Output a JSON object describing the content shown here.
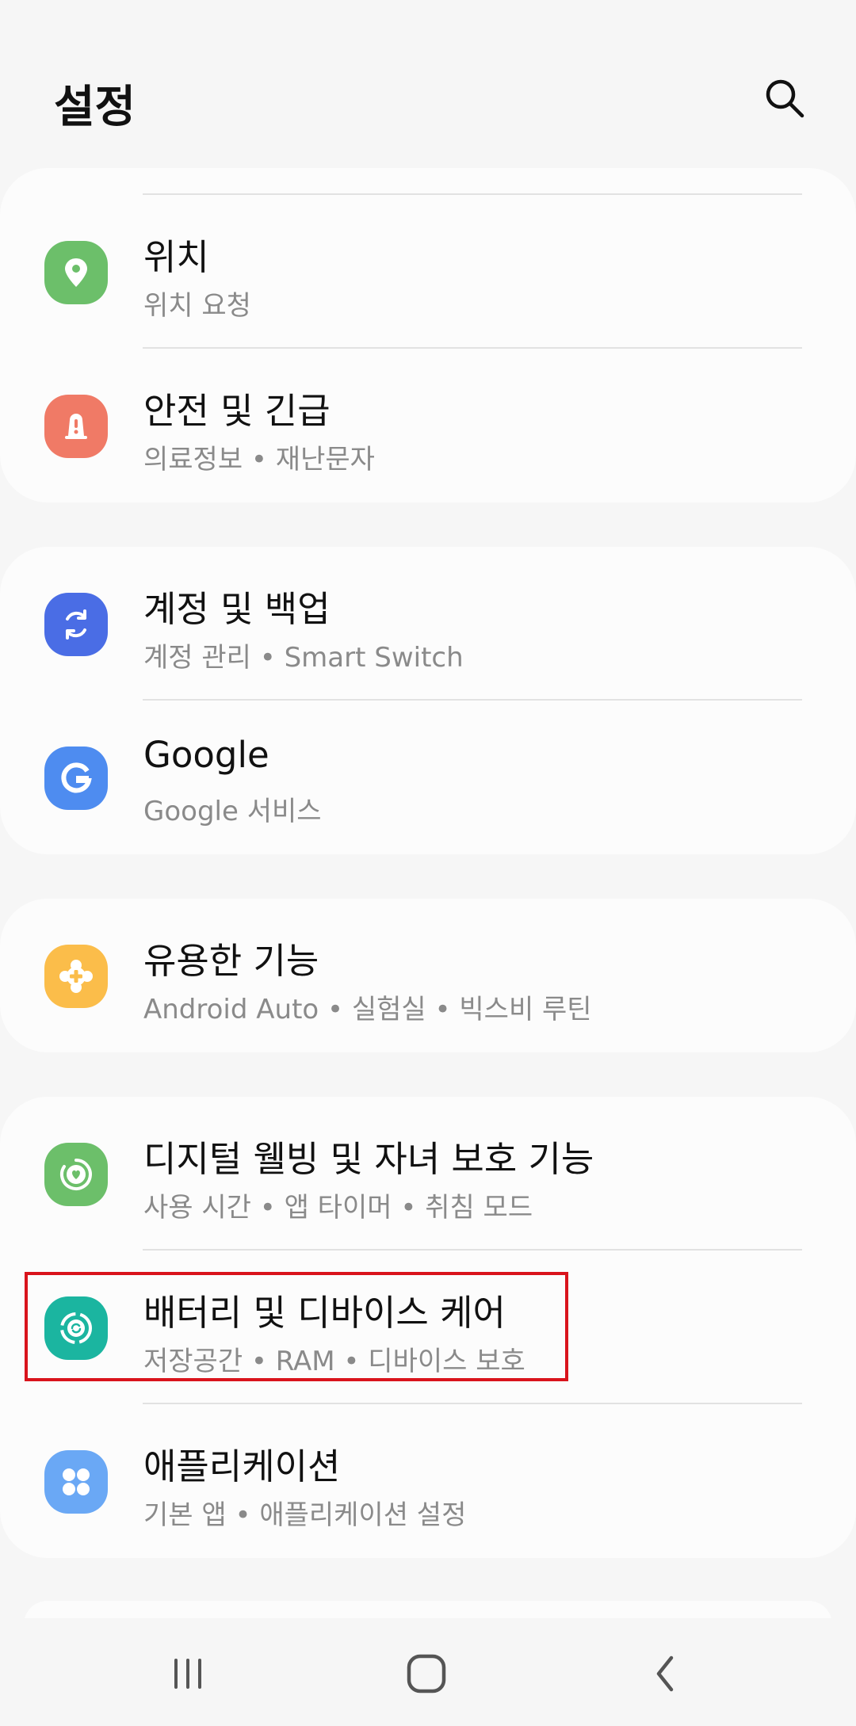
{
  "header": {
    "title": "설정"
  },
  "cards": [
    {
      "items": [
        {
          "title": "위치",
          "subtitle": "위치 요청",
          "icon": "location-pin-icon",
          "color": "#6cbf6a"
        },
        {
          "title": "안전 및 긴급",
          "subtitle": "의료정보  •  재난문자",
          "icon": "emergency-siren-icon",
          "color": "#f07a66"
        }
      ]
    },
    {
      "items": [
        {
          "title": "계정 및 백업",
          "subtitle": "계정 관리  •  Smart Switch",
          "icon": "sync-arrows-icon",
          "color": "#4a6de5"
        },
        {
          "title": "Google",
          "subtitle": "Google 서비스",
          "icon": "google-g-icon",
          "color": "#4e8cf0"
        }
      ]
    },
    {
      "items": [
        {
          "title": "유용한 기능",
          "subtitle": "Android Auto  •  실험실  •  빅스비 루틴",
          "icon": "puzzle-plus-icon",
          "color": "#fbbd4a"
        }
      ]
    },
    {
      "items": [
        {
          "title": "디지털 웰빙 및 자녀 보호 기능",
          "subtitle": "사용 시간  •  앱 타이머  •  취침 모드",
          "icon": "wellbeing-heart-icon",
          "color": "#6cbf6a"
        },
        {
          "title": "배터리 및 디바이스 케어",
          "subtitle": "저장공간  •  RAM  •  디바이스 보호",
          "icon": "device-care-icon",
          "color": "#1bb5a0"
        },
        {
          "title": "애플리케이션",
          "subtitle": "기본 앱  •  애플리케이션 설정",
          "icon": "apps-grid-icon",
          "color": "#6aa8f5"
        }
      ]
    }
  ],
  "navbar": {
    "recents_icon": "recent-apps-icon",
    "home_icon": "home-icon",
    "back_icon": "back-icon"
  }
}
